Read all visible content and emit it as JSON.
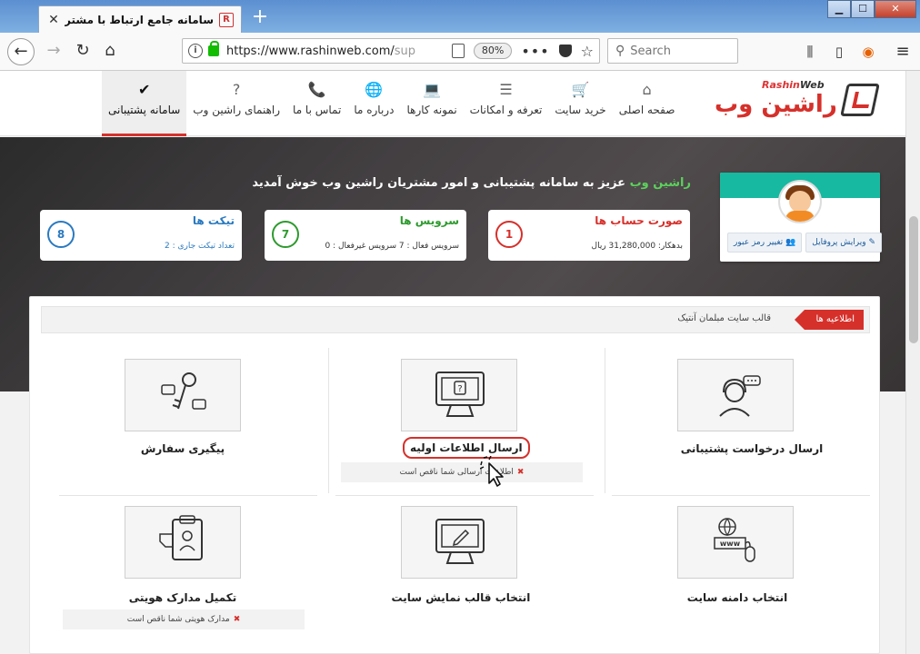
{
  "browser": {
    "tab_title": "سامانه جامع ارتباط با مشتریان راشین",
    "favicon_glyph": "R",
    "tab_close": "✕",
    "new_tab": "+",
    "win_min": "▁",
    "win_max": "☐",
    "win_close": "✕",
    "url_host": "https://www.rashinweb.com/",
    "url_path": "sup",
    "zoom": "80%",
    "url_dots": "•••",
    "search_placeholder": "Search"
  },
  "site": {
    "logo_latin_a": "Rashin",
    "logo_latin_b": "Web",
    "logo_fa": "راشین وب",
    "nav": [
      {
        "icon": "home-icon",
        "glyph": "⌂",
        "label": "صفحه اصلی"
      },
      {
        "icon": "cart-icon",
        "glyph": "🛒",
        "label": "خرید سایت"
      },
      {
        "icon": "server-icon",
        "glyph": "☰",
        "label": "تعرفه و امکانات"
      },
      {
        "icon": "laptop-icon",
        "glyph": "💻",
        "label": "نمونه کارها"
      },
      {
        "icon": "globe-icon",
        "glyph": "🌐",
        "label": "درباره ما"
      },
      {
        "icon": "phone-icon",
        "glyph": "📞",
        "label": "تماس با ما"
      },
      {
        "icon": "question-icon",
        "glyph": "?",
        "label": "راهنمای راشین وب"
      },
      {
        "icon": "check-circle-icon",
        "glyph": "✔",
        "label": "سامانه پشتیبانی"
      }
    ]
  },
  "hero": {
    "welcome_brand": "راشین وب",
    "welcome_rest": " عزیز به سامانه پشتیبانی و امور مشتریان راشین وب خوش آمدید",
    "profile": {
      "edit_profile": "✎ ویرایش پروفایل",
      "change_password": "👥 تغییر رمز عبور"
    },
    "cards": {
      "invoice": {
        "title": "صورت حساب ها",
        "sub": "بدهکار: 31,280,000 ریال",
        "count": "1"
      },
      "service": {
        "title": "سرویس ها",
        "sub": "سرویس فعال : 7  سرویس غیرفعال : 0",
        "count": "7"
      },
      "ticket": {
        "title": "تیکت ها",
        "sub": "تعداد تیکت جاری : 2",
        "count": "8"
      }
    }
  },
  "main": {
    "news_label": "اطلاعیه ها",
    "news_text": "قالب سایت مبلمان آنتیک",
    "tiles": {
      "support_request": "ارسال درخواست پشتیبانی",
      "send_info": "ارسال اطلاعات اولیه",
      "send_info_warning": "اطلاعات ارسالی شما ناقص است",
      "order_tracking": "پیگیری سفارش",
      "domain": "انتخاب دامنه سایت",
      "template": "انتخاب قالب نمایش سایت",
      "identity_docs": "تکمیل مدارک هویتی",
      "identity_warning": "مدارک هویتی شما ناقص است"
    },
    "warn_x": "✖"
  }
}
